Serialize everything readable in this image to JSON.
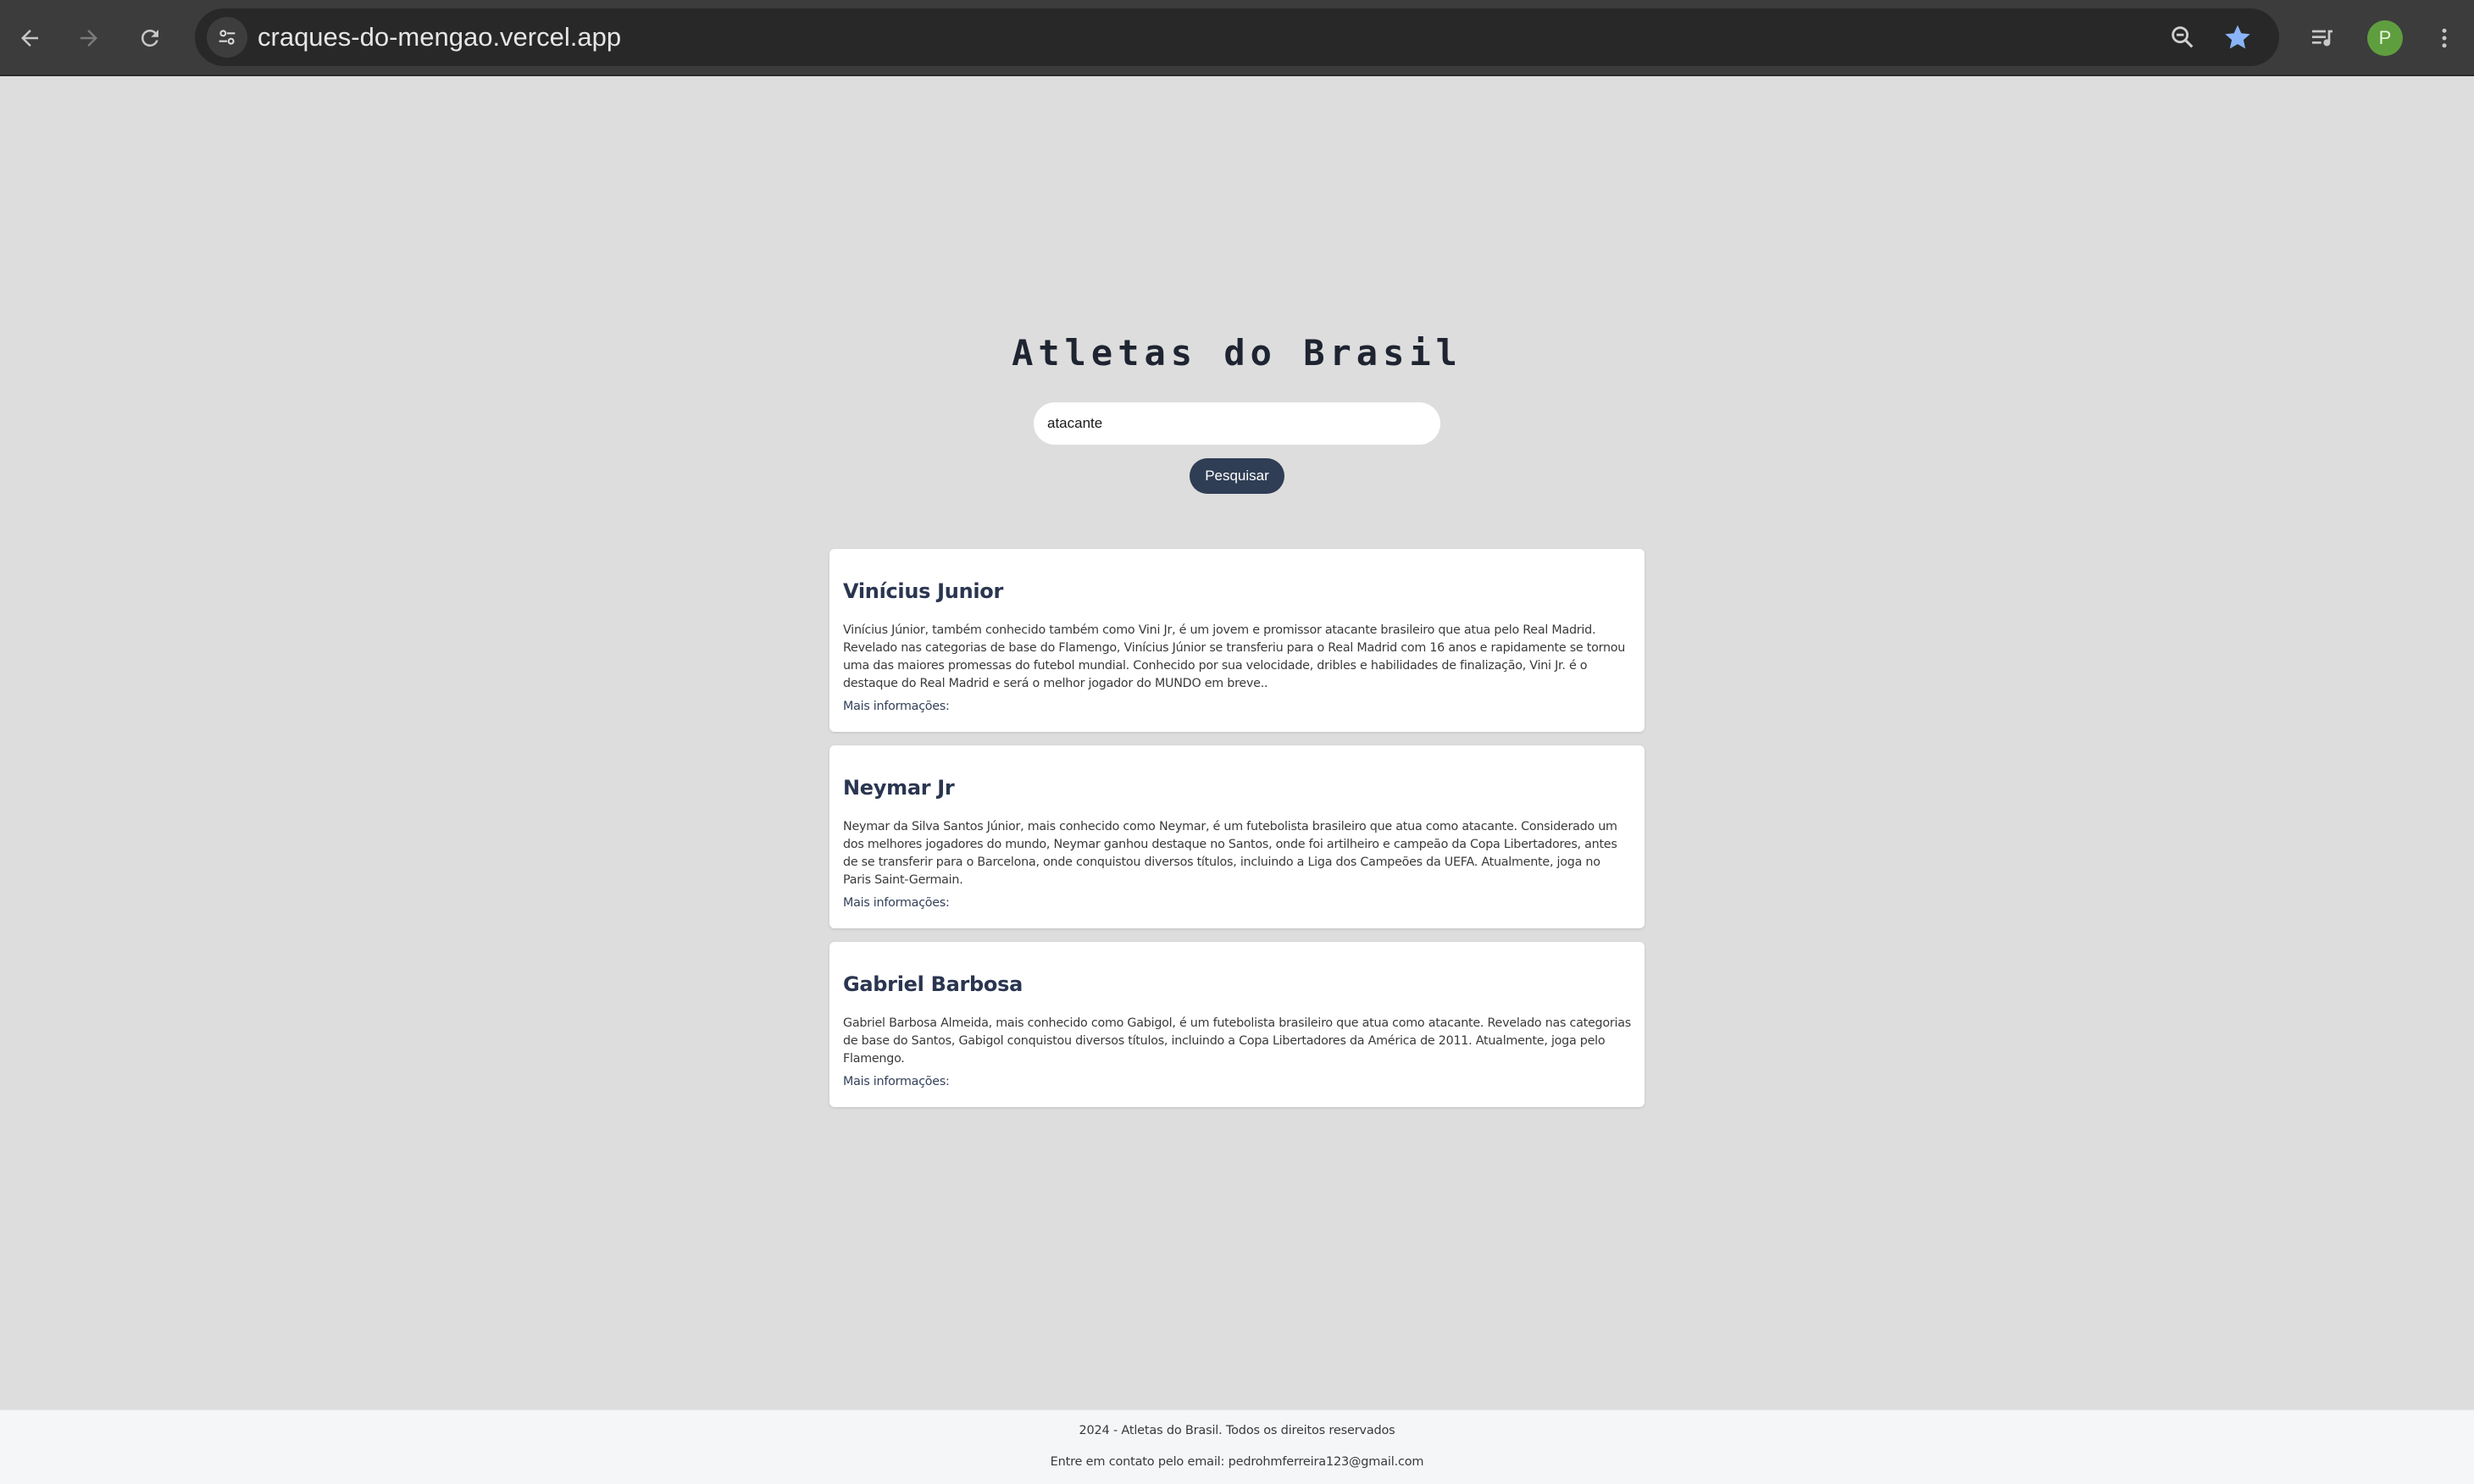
{
  "browser": {
    "url": "craques-do-mengao.vercel.app",
    "avatar_letter": "P",
    "icons": {
      "back": "arrow-left-icon",
      "forward": "arrow-right-icon",
      "reload": "reload-icon",
      "site_info": "tune-icon",
      "zoom": "zoom-out-icon",
      "bookmark": "star-icon",
      "media": "queue-music-icon",
      "menu": "kebab-menu-icon"
    },
    "colors": {
      "bookmark_star": "#8ab4f8",
      "avatar_bg": "#5f9e3f"
    }
  },
  "page": {
    "title": "Atletas do Brasil",
    "search": {
      "value": "atacante",
      "button_label": "Pesquisar"
    },
    "colors": {
      "button_bg": "#2f3d55",
      "card_title": "#2a3550"
    },
    "results": [
      {
        "name": "Vinícius Junior",
        "description": "Vinícius Júnior, também conhecido também como Vini Jr, é um jovem e promissor atacante brasileiro que atua pelo Real Madrid. Revelado nas categorias de base do Flamengo, Vinícius Júnior se transferiu para o Real Madrid com 16 anos e rapidamente se tornou uma das maiores promessas do futebol mundial. Conhecido por sua velocidade, dribles e habilidades de finalização, Vini Jr. é o destaque do Real Madrid e será o melhor jogador do MUNDO em breve..",
        "link_label": "Mais informações:"
      },
      {
        "name": "Neymar Jr",
        "description": "Neymar da Silva Santos Júnior, mais conhecido como Neymar, é um futebolista brasileiro que atua como atacante. Considerado um dos melhores jogadores do mundo, Neymar ganhou destaque no Santos, onde foi artilheiro e campeão da Copa Libertadores, antes de se transferir para o Barcelona, onde conquistou diversos títulos, incluindo a Liga dos Campeões da UEFA. Atualmente, joga no Paris Saint-Germain.",
        "link_label": "Mais informações:"
      },
      {
        "name": "Gabriel Barbosa",
        "description": "Gabriel Barbosa Almeida, mais conhecido como Gabigol, é um futebolista brasileiro que atua como atacante. Revelado nas categorias de base do Santos, Gabigol conquistou diversos títulos, incluindo a Copa Libertadores da América de 2011. Atualmente, joga pelo Flamengo.",
        "link_label": "Mais informações:"
      }
    ]
  },
  "footer": {
    "copyright": "2024 - Atletas do Brasil. Todos os direitos reservados",
    "contact": "Entre em contato pelo email: pedrohmferreira123@gmail.com"
  }
}
